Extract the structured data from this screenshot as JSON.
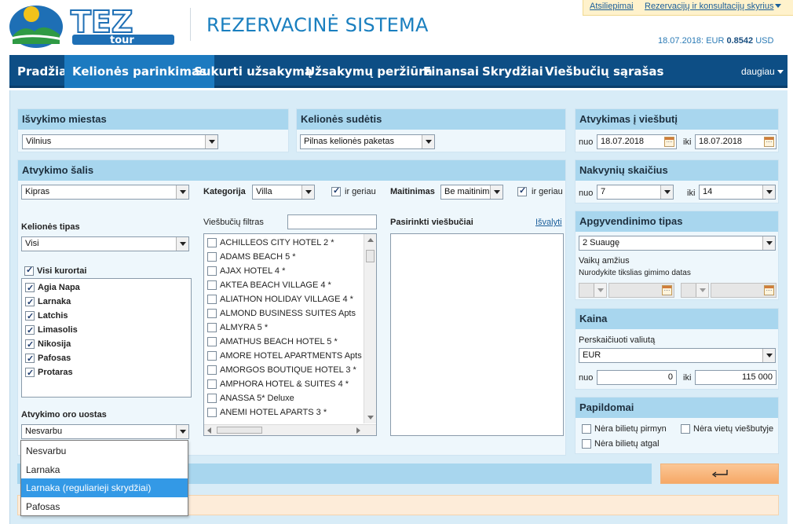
{
  "header": {
    "logo_text": "TEZ",
    "logo_subtext": "tour",
    "app_title": "REZERVACINĖ SISTEMA",
    "links": [
      "Atsiliepimai",
      "Rezervacijų ir konsultacijų skyrius"
    ],
    "rate_date": "18.07.2018:",
    "rate_label": "EUR",
    "rate_value": "0.8542",
    "rate_currency": "USD"
  },
  "nav": {
    "items": [
      "Pradžia",
      "Kelionės parinkimas",
      "Sukurti užsakymą",
      "Užsakymų peržiūra",
      "Finansai",
      "Skrydžiai",
      "Viešbučių sąrašas"
    ],
    "active": "Kelionės parinkimas",
    "more": "daugiau"
  },
  "departure_city": {
    "title": "Išvykimo miestas",
    "value": "Vilnius"
  },
  "trip_composition": {
    "title": "Kelionės sudėtis",
    "value": "Pilnas kelionės paketas"
  },
  "hotel_arrival": {
    "title": "Atvykimas į viešbutį",
    "from_label": "nuo",
    "from_value": "18.07.2018",
    "to_label": "iki",
    "to_value": "18.07.2018"
  },
  "country": {
    "title": "Atvykimo šalis",
    "value": "Kipras",
    "category_label": "Kategorija",
    "category_value": "Villa",
    "category_better": "ir geriau",
    "meal_label": "Maitinimas",
    "meal_value": "Be maitinimo",
    "meal_better": "ir geriau",
    "trip_type_label": "Kelionės tipas",
    "trip_type_value": "Visi",
    "all_resorts": "Visi kurortai",
    "resorts": [
      "Agia Napa",
      "Larnaka",
      "Latchis",
      "Limasolis",
      "Nikosija",
      "Pafosas",
      "Protaras"
    ],
    "hotel_filter_label": "Viešbučių filtras",
    "hotel_filter_value": "",
    "hotels": [
      "ACHILLEOS CITY HOTEL 2 *",
      "ADAMS BEACH 5 *",
      "AJAX HOTEL 4 *",
      "AKTEA BEACH VILLAGE 4 *",
      "ALIATHON HOLIDAY VILLAGE 4 *",
      "ALMOND BUSINESS SUITES Apts",
      "ALMYRA 5 *",
      "AMATHUS BEACH HOTEL 5 *",
      "AMORE HOTEL APARTMENTS Apts",
      "AMORGOS BOUTIQUE HOTEL 3 *",
      "AMPHORA HOTEL & SUITES 4 *",
      "ANASSA 5* Deluxe",
      "ANEMI HOTEL APARTS 3 *"
    ],
    "selected_hotels_label": "Pasirinkti viešbučiai",
    "clear_link": "Išvalyti",
    "airport_label": "Atvykimo oro uostas",
    "airport_value": "Nesvarbu",
    "airport_options": [
      "Nesvarbu",
      "Larnaka",
      "Larnaka (reguliarieji skrydžiai)",
      "Pafosas"
    ],
    "airport_highlighted": "Larnaka (reguliarieji skrydžiai)"
  },
  "nights": {
    "title": "Nakvynių skaičius",
    "from_label": "nuo",
    "from_value": "7",
    "to_label": "iki",
    "to_value": "14"
  },
  "accommodation": {
    "title": "Apgyvendinimo tipas",
    "value": "2 Suaugę",
    "children_age_label": "Vaikų amžius",
    "birthdate_hint": "Nurodykite tikslias gimimo datas"
  },
  "price": {
    "title": "Kaina",
    "currency_label": "Perskaičiuoti valiutą",
    "currency_value": "EUR",
    "from_label": "nuo",
    "from_value": "0",
    "to_label": "iki",
    "to_value": "115 000"
  },
  "extras": {
    "title": "Papildomai",
    "options": [
      "Nėra bilietų pirmyn",
      "Nėra vietų viešbutyje",
      "Nėra bilietų atgal"
    ]
  },
  "colors": {
    "nav_bg": "#0d4e85",
    "nav_active": "#1c7ac0",
    "panel_header": "#a8d6ee",
    "frame_bg": "#d8ecf7",
    "search_button": "#f6a866",
    "highlight": "#3399e6"
  }
}
